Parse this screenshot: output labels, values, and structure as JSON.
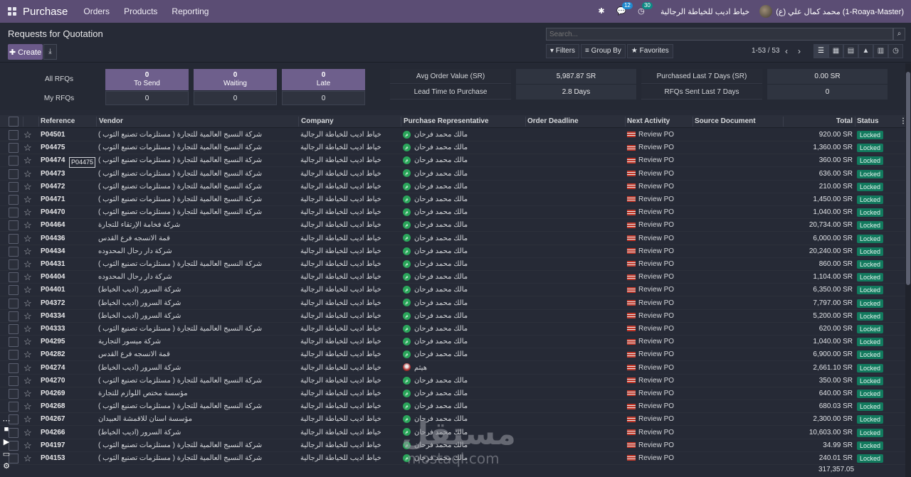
{
  "topbar": {
    "app_title": "Purchase",
    "menu": [
      "Orders",
      "Products",
      "Reporting"
    ],
    "chat_count": "12",
    "activity_count": "30",
    "company": "خياط اديب للخياطة الرجالية",
    "user": "محمد كمال علي (ع) (1-Roaya-Master)"
  },
  "control": {
    "title": "Requests for Quotation",
    "create_label": "Create",
    "search_placeholder": "Search...",
    "filters_label": "Filters",
    "group_by_label": "Group By",
    "favorites_label": "Favorites",
    "pager": "1-53 / 53"
  },
  "dashboard": {
    "all_rfqs_label": "All RFQs",
    "my_rfqs_label": "My RFQs",
    "to_send": {
      "label": "To Send",
      "all": "0",
      "mine": "0"
    },
    "waiting": {
      "label": "Waiting",
      "all": "0",
      "mine": "0"
    },
    "late": {
      "label": "Late",
      "all": "0",
      "mine": "0"
    },
    "avg_order_value_label": "Avg Order Value (SR)",
    "avg_order_value": "5,987.87 SR",
    "lead_time_label": "Lead Time to Purchase",
    "lead_time": "2.8  Days",
    "purchased_last7_label": "Purchased Last 7 Days (SR)",
    "purchased_last7": "0.00 SR",
    "rfqs_sent_last7_label": "RFQs Sent Last 7 Days",
    "rfqs_sent_last7": "0"
  },
  "table": {
    "columns": [
      "Reference",
      "Vendor",
      "Company",
      "Purchase Representative",
      "Order Deadline",
      "Next Activity",
      "Source Document",
      "Total",
      "Status"
    ],
    "rows": [
      {
        "ref": "P04501",
        "vendor": "شركة النسيج العالمية للتجارة ( مستلزمات تصنيع الثوب )",
        "company": "خياط اديب للخياطة الرجالية",
        "rep": "مالك محمد فرحان",
        "activity": "Review PO",
        "total": "920.00 SR",
        "status": "Locked"
      },
      {
        "ref": "P04475",
        "vendor": "شركة النسيج العالمية للتجارة ( مستلزمات تصنيع الثوب )",
        "company": "خياط اديب للخياطة الرجالية",
        "rep": "مالك محمد فرحان",
        "activity": "Review PO",
        "total": "1,360.00 SR",
        "status": "Locked"
      },
      {
        "ref": "P04474",
        "vendor": "شركة النسيج العالمية للتجارة ( مستلزمات تصنيع الثوب )",
        "company": "خياط اديب للخياطة الرجالية",
        "rep": "مالك محمد فرحان",
        "activity": "Review PO",
        "total": "360.00 SR",
        "status": "Locked"
      },
      {
        "ref": "P04473",
        "vendor": "شركة النسيج العالمية للتجارة ( مستلزمات تصنيع الثوب )",
        "company": "خياط اديب للخياطة الرجالية",
        "rep": "مالك محمد فرحان",
        "activity": "Review PO",
        "total": "636.00 SR",
        "status": "Locked"
      },
      {
        "ref": "P04472",
        "vendor": "شركة النسيج العالمية للتجارة ( مستلزمات تصنيع الثوب )",
        "company": "خياط اديب للخياطة الرجالية",
        "rep": "مالك محمد فرحان",
        "activity": "Review PO",
        "total": "210.00 SR",
        "status": "Locked"
      },
      {
        "ref": "P04471",
        "vendor": "شركة النسيج العالمية للتجارة ( مستلزمات تصنيع الثوب )",
        "company": "خياط اديب للخياطة الرجالية",
        "rep": "مالك محمد فرحان",
        "activity": "Review PO",
        "total": "1,450.00 SR",
        "status": "Locked"
      },
      {
        "ref": "P04470",
        "vendor": "شركة النسيج العالمية للتجارة ( مستلزمات تصنيع الثوب )",
        "company": "خياط اديب للخياطة الرجالية",
        "rep": "مالك محمد فرحان",
        "activity": "Review PO",
        "total": "1,040.00 SR",
        "status": "Locked"
      },
      {
        "ref": "P04464",
        "vendor": "شركة فخامة الإرتقاء للتجارة",
        "company": "خياط اديب للخياطة الرجالية",
        "rep": "مالك محمد فرحان",
        "activity": "Review PO",
        "total": "20,734.00 SR",
        "status": "Locked"
      },
      {
        "ref": "P04436",
        "vendor": "قمة الانسجه فرع القدس",
        "company": "خياط اديب للخياطة الرجالية",
        "rep": "مالك محمد فرحان",
        "activity": "Review PO",
        "total": "6,000.00 SR",
        "status": "Locked"
      },
      {
        "ref": "P04434",
        "vendor": "شركة دار رحال المحدوده",
        "company": "خياط اديب للخياطة الرجالية",
        "rep": "مالك محمد فرحان",
        "activity": "Review PO",
        "total": "20,240.00 SR",
        "status": "Locked"
      },
      {
        "ref": "P04431",
        "vendor": "شركة النسيج العالمية للتجارة ( مستلزمات تصنيع الثوب )",
        "company": "خياط اديب للخياطة الرجالية",
        "rep": "مالك محمد فرحان",
        "activity": "Review PO",
        "total": "860.00 SR",
        "status": "Locked"
      },
      {
        "ref": "P04404",
        "vendor": "شركة دار رحال المحدوده",
        "company": "خياط اديب للخياطة الرجالية",
        "rep": "مالك محمد فرحان",
        "activity": "Review PO",
        "total": "1,104.00 SR",
        "status": "Locked"
      },
      {
        "ref": "P04401",
        "vendor": "شركة السرور (اديب الخياط)",
        "company": "خياط اديب للخياطة الرجالية",
        "rep": "مالك محمد فرحان",
        "activity": "Review PO",
        "total": "6,350.00 SR",
        "status": "Locked"
      },
      {
        "ref": "P04372",
        "vendor": "شركة السرور (اديب الخياط)",
        "company": "خياط اديب للخياطة الرجالية",
        "rep": "مالك محمد فرحان",
        "activity": "Review PO",
        "total": "7,797.00 SR",
        "status": "Locked"
      },
      {
        "ref": "P04334",
        "vendor": "شركة السرور (اديب الخياط)",
        "company": "خياط اديب للخياطة الرجالية",
        "rep": "مالك محمد فرحان",
        "activity": "Review PO",
        "total": "5,200.00 SR",
        "status": "Locked"
      },
      {
        "ref": "P04333",
        "vendor": "شركة النسيج العالمية للتجارة ( مستلزمات تصنيع الثوب )",
        "company": "خياط اديب للخياطة الرجالية",
        "rep": "مالك محمد فرحان",
        "activity": "Review PO",
        "total": "620.00 SR",
        "status": "Locked"
      },
      {
        "ref": "P04295",
        "vendor": "شركة ميسور التجارية",
        "company": "خياط اديب للخياطة الرجالية",
        "rep": "مالك محمد فرحان",
        "activity": "Review PO",
        "total": "1,040.00 SR",
        "status": "Locked"
      },
      {
        "ref": "P04282",
        "vendor": "قمة الانسجه فرع القدس",
        "company": "خياط اديب للخياطة الرجالية",
        "rep": "مالك محمد فرحان",
        "activity": "Review PO",
        "total": "6,900.00 SR",
        "status": "Locked"
      },
      {
        "ref": "P04274",
        "vendor": "شركة السرور (اديب الخياط)",
        "company": "خياط اديب للخياطة الرجالية",
        "rep": "هيثم",
        "activity": "Review PO",
        "total": "2,661.10 SR",
        "status": "Locked"
      },
      {
        "ref": "P04270",
        "vendor": "شركة النسيج العالمية للتجارة ( مستلزمات تصنيع الثوب )",
        "company": "خياط اديب للخياطة الرجالية",
        "rep": "مالك محمد فرحان",
        "activity": "Review PO",
        "total": "350.00 SR",
        "status": "Locked"
      },
      {
        "ref": "P04269",
        "vendor": "مؤسسة مختص اللوازم للتجارة",
        "company": "خياط اديب للخياطة الرجالية",
        "rep": "مالك محمد فرحان",
        "activity": "Review PO",
        "total": "640.00 SR",
        "status": "Locked"
      },
      {
        "ref": "P04268",
        "vendor": "شركة النسيج العالمية للتجارة ( مستلزمات تصنيع الثوب )",
        "company": "خياط اديب للخياطة الرجالية",
        "rep": "مالك محمد فرحان",
        "activity": "Review PO",
        "total": "680.03 SR",
        "status": "Locked"
      },
      {
        "ref": "P04267",
        "vendor": "مؤسسة اسنان للاقمشة العبيدان",
        "company": "خياط اديب للخياطة الرجالية",
        "rep": "مالك محمد فرحان",
        "activity": "Review PO",
        "total": "2,300.00 SR",
        "status": "Locked"
      },
      {
        "ref": "P04266",
        "vendor": "شركة السرور (اديب الخياط)",
        "company": "خياط اديب للخياطة الرجالية",
        "rep": "مالك محمد فرحان",
        "activity": "Review PO",
        "total": "10,603.00 SR",
        "status": "Locked"
      },
      {
        "ref": "P04197",
        "vendor": "شركة النسيج العالمية للتجارة ( مستلزمات تصنيع الثوب )",
        "company": "خياط اديب للخياطة الرجالية",
        "rep": "مالك محمد فرحان",
        "activity": "Review PO",
        "total": "34.99 SR",
        "status": "Locked"
      },
      {
        "ref": "P04153",
        "vendor": "شركة النسيج العالمية للتجارة ( مستلزمات تصنيع الثوب )",
        "company": "خياط اديب للخياطة الرجالية",
        "rep": "مالك محمد فرحان",
        "activity": "Review PO",
        "total": "240.01 SR",
        "status": "Locked"
      }
    ],
    "grand_total": "317,357.05"
  },
  "tooltip": "P04475",
  "watermark": {
    "top": "مستقل",
    "bottom": "mostaql.com"
  },
  "colors": {
    "topbar": "#5b4d74",
    "primary": "#6b5a8a",
    "locked": "#127a5e",
    "avatar": "#2aa55a"
  }
}
